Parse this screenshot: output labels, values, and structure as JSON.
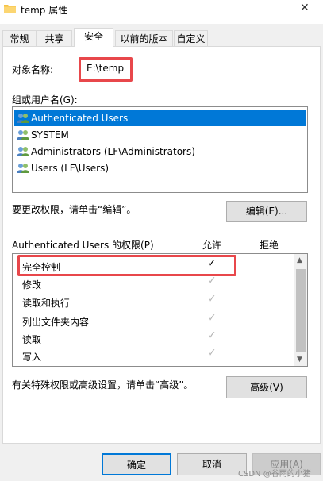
{
  "window": {
    "title": "temp 属性",
    "close_symbol": "✕"
  },
  "tabs": [
    {
      "label": "常规"
    },
    {
      "label": "共享"
    },
    {
      "label": "安全"
    },
    {
      "label": "以前的版本"
    },
    {
      "label": "自定义"
    }
  ],
  "object": {
    "label": "对象名称:",
    "value": "E:\\temp"
  },
  "groups": {
    "label": "组或用户名(G):",
    "items": [
      {
        "name": "Authenticated Users",
        "selected": true
      },
      {
        "name": "SYSTEM",
        "selected": false
      },
      {
        "name": "Administrators (LF\\Administrators)",
        "selected": false
      },
      {
        "name": "Users (LF\\Users)",
        "selected": false
      }
    ]
  },
  "edit_hint": "要更改权限，请单击“编辑”。",
  "edit_button": "编辑(E)...",
  "permissions": {
    "header": "Authenticated Users 的权限(P)",
    "allow_label": "允许",
    "deny_label": "拒绝",
    "check_symbol": "✓",
    "rows": [
      {
        "name": "完全控制",
        "allow": true,
        "allow_dim": false
      },
      {
        "name": "修改",
        "allow": true,
        "allow_dim": true
      },
      {
        "name": "读取和执行",
        "allow": true,
        "allow_dim": true
      },
      {
        "name": "列出文件夹内容",
        "allow": true,
        "allow_dim": true
      },
      {
        "name": "读取",
        "allow": true,
        "allow_dim": true
      },
      {
        "name": "写入",
        "allow": true,
        "allow_dim": true
      }
    ]
  },
  "advanced_hint": "有关特殊权限或高级设置，请单击“高级”。",
  "advanced_button": "高级(V)",
  "footer": {
    "ok": "确定",
    "cancel": "取消",
    "apply": "应用(A)"
  },
  "watermark": "CSDN @谷雨的小猪",
  "colors": {
    "accent": "#0078d7",
    "highlight": "#e8474b"
  }
}
